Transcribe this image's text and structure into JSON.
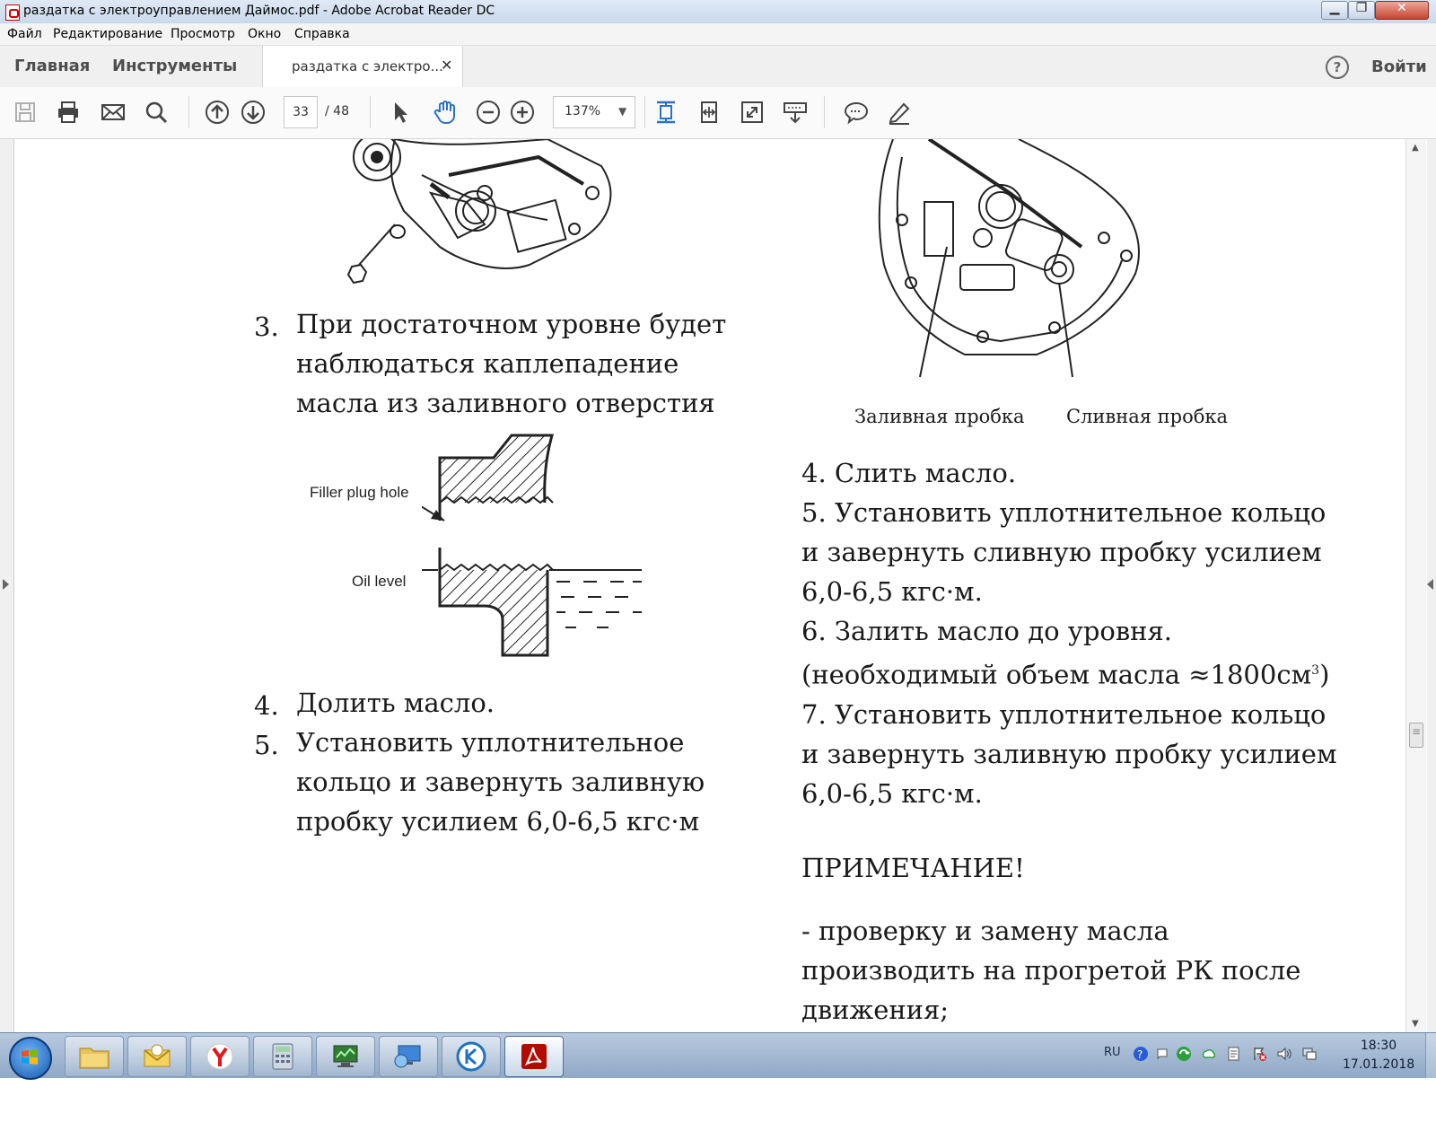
{
  "window": {
    "title": "раздатка с электроуправлением Даймос.pdf - Adobe Acrobat Reader DC",
    "min_glyph": "▁",
    "max_glyph": "❐",
    "close_glyph": "✕"
  },
  "menu": [
    "Файл",
    "Редактирование",
    "Просмотр",
    "Окно",
    "Справка"
  ],
  "tabs": {
    "home": "Главная",
    "tools": "Инструменты",
    "document": "раздатка с электро...",
    "close_glyph": "✕",
    "help_glyph": "?",
    "login": "Войти"
  },
  "toolbar": {
    "page_current": "33",
    "page_sep_total": "/  48",
    "zoom": "137%",
    "zoom_caret": "▼",
    "icons": [
      "save-icon",
      "print-icon",
      "email-icon",
      "search-icon",
      "page-up-icon",
      "page-down-icon",
      "select-icon",
      "hand-icon",
      "zoom-out-icon",
      "zoom-in-icon",
      "fit-page-icon",
      "fit-width-icon",
      "full-screen-icon",
      "scroll-mode-icon",
      "comment-icon",
      "sign-icon"
    ]
  },
  "document": {
    "left": {
      "item3_num": "3.",
      "item3_lines": [
        "При достаточном уровне будет",
        "наблюдаться каплепадение",
        "масла из заливного отверстия"
      ],
      "diagram_filler": "Filler plug hole",
      "diagram_oil": "Oil level",
      "item4_num": "4.",
      "item4": "Долить масло.",
      "item5_num": "5.",
      "item5_lines": [
        "Установить уплотнительное",
        "кольцо и завернуть заливную",
        "пробку усилием 6,0-6,5 кгс·м"
      ]
    },
    "right": {
      "caption_fill": "Заливная пробка",
      "caption_drain": "Сливная пробка",
      "lines": [
        "4. Слить масло.",
        "5. Установить уплотнительное кольцо",
        "и завернуть сливную пробку усилием",
        "6,0-6,5 кгс·м.",
        "6.  Залить масло до уровня.",
        "(необходимый объем масла ≈1800см",
        "7. Установить уплотнительное кольцо",
        "и завернуть заливную пробку усилием",
        "6,0-6,5 кгс·м."
      ],
      "superscript": "3",
      "close_paren": ")",
      "note_title": "ПРИМЕЧАНИЕ!",
      "note_lines": [
        "- проверку и замену масла",
        "производить на прогретой РК после",
        "движения;"
      ]
    }
  },
  "taskbar": {
    "lang": "RU",
    "time": "18:30",
    "date": "17.01.2018",
    "apps": [
      "explorer-icon",
      "mail-icon",
      "yandex-browser-icon",
      "calculator-icon",
      "monitor-icon",
      "remote-desktop-icon",
      "k-app-icon",
      "acrobat-icon"
    ]
  },
  "colors": {
    "acrobat_red": "#cc0000",
    "accent_blue": "#2a72c7"
  }
}
